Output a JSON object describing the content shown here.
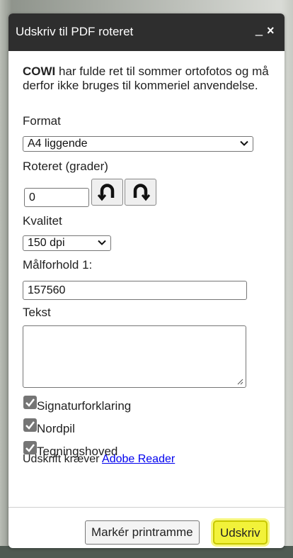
{
  "dialog": {
    "title": "Udskriv til PDF roteret",
    "minimize_glyph": "_",
    "close_glyph": "×"
  },
  "notice": {
    "brand": "COWI",
    "text": " har fulde ret til sommer ortofotos og må derfor ikke bruges til kommeriel anvendelse."
  },
  "format": {
    "label": "Format",
    "selected": "A4 liggende"
  },
  "rotation": {
    "label": "Roteret (grader)",
    "value": "0",
    "rotate_left_icon": "rotate-left-icon",
    "rotate_right_icon": "rotate-right-icon"
  },
  "quality": {
    "label": "Kvalitet",
    "selected": "150 dpi"
  },
  "scale": {
    "label": "Målforhold 1:",
    "value": "157560"
  },
  "text": {
    "label": "Tekst",
    "value": ""
  },
  "checkboxes": [
    {
      "label": "Signaturforklaring",
      "checked": true
    },
    {
      "label": "Nordpil",
      "checked": true
    },
    {
      "label": "Tegningshoved",
      "checked": true
    }
  ],
  "footer": {
    "requires_text": "Udskrift kræver ",
    "link_text": "Adobe Reader"
  },
  "buttons": {
    "mark_frame": "Markér printramme",
    "print": "Udskriv"
  },
  "colors": {
    "titlebar": "#2e2e2e",
    "highlight": "#f2f23a",
    "link": "#0000ee",
    "checkbox": "#757575"
  }
}
